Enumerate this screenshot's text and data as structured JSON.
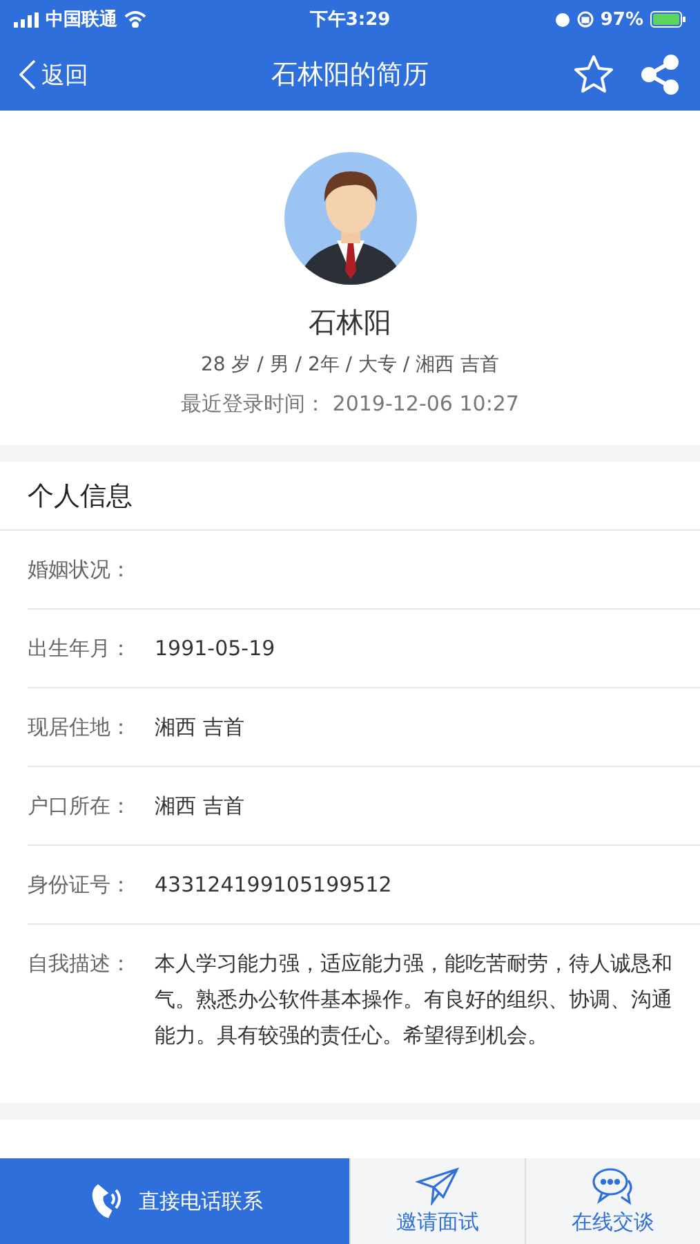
{
  "status_bar": {
    "carrier": "中国联通",
    "time": "下午3:29",
    "battery": "97%"
  },
  "nav": {
    "back": "返回",
    "title": "石林阳的简历"
  },
  "profile": {
    "name": "石林阳",
    "summary": "28 岁 / 男 / 2年 / 大专 / 湘西 吉首",
    "last_login": "最近登录时间：  2019-12-06 10:27"
  },
  "personal_info": {
    "title": "个人信息",
    "rows": [
      {
        "label": "婚姻状况："
      },
      {
        "label": "出生年月：",
        "value": "1991-05-19"
      },
      {
        "label": "现居住地：",
        "value": "湘西 吉首"
      },
      {
        "label": "户口所在：",
        "value": "湘西 吉首"
      },
      {
        "label": "身份证号：",
        "value": "433124199105199512"
      },
      {
        "label": "自我描述：",
        "value": "本人学习能力强，适应能力强，能吃苦耐劳，待人诚恳和气。熟悉办公软件基本操作。有良好的组织、协调、沟通能力。具有较强的责任心。希望得到机会。"
      }
    ]
  },
  "bottom_bar": [
    {
      "kind": "call",
      "label": "直接电话联系"
    },
    {
      "kind": "invite",
      "label": "邀请面试"
    },
    {
      "kind": "chat",
      "label": "在线交谈"
    }
  ]
}
